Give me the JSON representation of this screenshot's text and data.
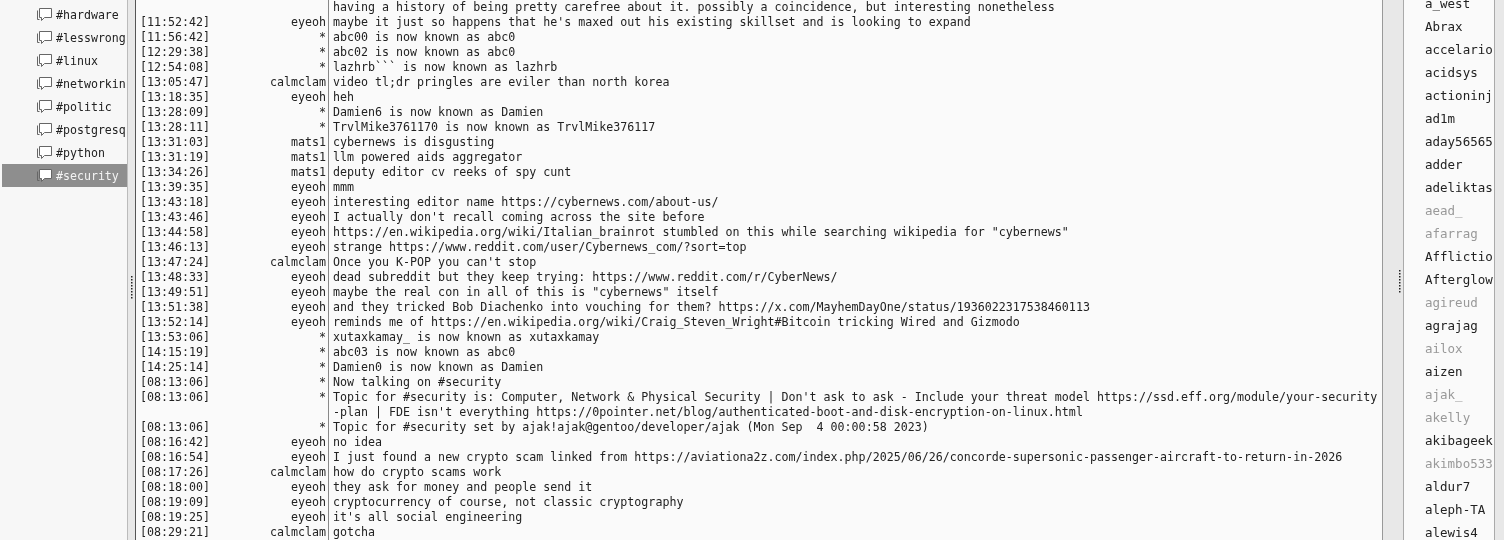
{
  "sidebar": {
    "channels": [
      {
        "label": "#hardware",
        "selected": false
      },
      {
        "label": "#lesswrong",
        "selected": false
      },
      {
        "label": "#linux",
        "selected": false
      },
      {
        "label": "#networkin",
        "selected": false
      },
      {
        "label": "#politic",
        "selected": false
      },
      {
        "label": "#postgresq",
        "selected": false
      },
      {
        "label": "#python",
        "selected": false
      },
      {
        "label": "#security",
        "selected": true
      }
    ]
  },
  "chat": {
    "lines": [
      {
        "text": "having a history of being pretty carefree about it. possibly a coincidence, but interesting nonetheless"
      },
      {
        "time": "[11:52:42]",
        "nick": "eyeoh",
        "text": "maybe it just so happens that he's maxed out his existing skillset and is looking to expand"
      },
      {
        "time": "[11:56:42]",
        "nick": "*",
        "text": "abc00 is now known as abc0"
      },
      {
        "time": "[12:29:38]",
        "nick": "*",
        "text": "abc02 is now known as abc0"
      },
      {
        "time": "[12:54:08]",
        "nick": "*",
        "text": "lazhrb``` is now known as lazhrb"
      },
      {
        "time": "[13:05:47]",
        "nick": "calmclam",
        "text": "video tl;dr pringles are eviler than north korea"
      },
      {
        "time": "[13:18:35]",
        "nick": "eyeoh",
        "text": "heh"
      },
      {
        "time": "[13:28:09]",
        "nick": "*",
        "text": "Damien6 is now known as Damien"
      },
      {
        "time": "[13:28:11]",
        "nick": "*",
        "text": "TrvlMike3761170 is now known as TrvlMike376117"
      },
      {
        "time": "[13:31:03]",
        "nick": "mats1",
        "text": "cybernews is disgusting"
      },
      {
        "time": "[13:31:19]",
        "nick": "mats1",
        "text": "llm powered aids aggregator"
      },
      {
        "time": "[13:34:26]",
        "nick": "mats1",
        "text": "deputy editor cv reeks of spy cunt"
      },
      {
        "time": "[13:39:35]",
        "nick": "eyeoh",
        "text": "mmm"
      },
      {
        "time": "[13:43:18]",
        "nick": "eyeoh",
        "text": "interesting editor name https://cybernews.com/about-us/"
      },
      {
        "time": "[13:43:46]",
        "nick": "eyeoh",
        "text": "I actually don't recall coming across the site before"
      },
      {
        "time": "[13:44:58]",
        "nick": "eyeoh",
        "text": "https://en.wikipedia.org/wiki/Italian_brainrot stumbled on this while searching wikipedia for \"cybernews\""
      },
      {
        "time": "[13:46:13]",
        "nick": "eyeoh",
        "text": "strange https://www.reddit.com/user/Cybernews_com/?sort=top"
      },
      {
        "time": "[13:47:24]",
        "nick": "calmclam",
        "text": "Once you K-POP you can't stop"
      },
      {
        "time": "[13:48:33]",
        "nick": "eyeoh",
        "text": "dead subreddit but they keep trying: https://www.reddit.com/r/CyberNews/"
      },
      {
        "time": "[13:49:51]",
        "nick": "eyeoh",
        "text": "maybe the real con in all of this is \"cybernews\" itself"
      },
      {
        "time": "[13:51:38]",
        "nick": "eyeoh",
        "text": "and they tricked Bob Diachenko into vouching for them? https://x.com/MayhemDayOne/status/1936022317538460113"
      },
      {
        "time": "[13:52:14]",
        "nick": "eyeoh",
        "text": "reminds me of https://en.wikipedia.org/wiki/Craig_Steven_Wright#Bitcoin tricking Wired and Gizmodo"
      },
      {
        "time": "[13:53:06]",
        "nick": "*",
        "text": "xutaxkamay_ is now known as xutaxkamay"
      },
      {
        "time": "[14:15:19]",
        "nick": "*",
        "text": "abc03 is now known as abc0"
      },
      {
        "time": "[14:25:14]",
        "nick": "*",
        "text": "Damien0 is now known as Damien"
      },
      {
        "time": "[08:13:06]",
        "nick": "*",
        "text": "Now talking on #security"
      },
      {
        "time": "[08:13:06]",
        "nick": "*",
        "text": "Topic for #security is: Computer, Network & Physical Security | Don't ask to ask - Include your threat model https://ssd.eff.org/module/your-security-plan | FDE isn't everything https://0pointer.net/blog/authenticated-boot-and-disk-encryption-on-linux.html"
      },
      {
        "time": "[08:13:06]",
        "nick": "*",
        "text": "Topic for #security set by ajak!ajak@gentoo/developer/ajak (Mon Sep  4 00:00:58 2023)"
      },
      {
        "time": "[08:16:42]",
        "nick": "eyeoh",
        "text": "no idea"
      },
      {
        "time": "[08:16:54]",
        "nick": "eyeoh",
        "text": "I just found a new crypto scam linked from https://aviationa2z.com/index.php/2025/06/26/concorde-supersonic-passenger-aircraft-to-return-in-2026"
      },
      {
        "time": "[08:17:26]",
        "nick": "calmclam",
        "text": "how do crypto scams work"
      },
      {
        "time": "[08:18:00]",
        "nick": "eyeoh",
        "text": "they ask for money and people send it"
      },
      {
        "time": "[08:19:09]",
        "nick": "eyeoh",
        "text": "cryptocurrency of course, not classic cryptography"
      },
      {
        "time": "[08:19:25]",
        "nick": "eyeoh",
        "text": "it's all social engineering"
      },
      {
        "time": "[08:29:21]",
        "nick": "calmclam",
        "text": "gotcha"
      }
    ]
  },
  "users": [
    {
      "name": "a_west",
      "away": false
    },
    {
      "name": "Abrax",
      "away": false
    },
    {
      "name": "accelario",
      "away": false
    },
    {
      "name": "acidsys",
      "away": false
    },
    {
      "name": "actioninj",
      "away": false
    },
    {
      "name": "ad1m",
      "away": false
    },
    {
      "name": "aday56565",
      "away": false
    },
    {
      "name": "adder",
      "away": false
    },
    {
      "name": "adeliktas",
      "away": false
    },
    {
      "name": "aead_",
      "away": true
    },
    {
      "name": "afarrag",
      "away": true
    },
    {
      "name": "Afflictio",
      "away": false
    },
    {
      "name": "Afterglow",
      "away": false
    },
    {
      "name": "agireud",
      "away": true
    },
    {
      "name": "agrajag",
      "away": false
    },
    {
      "name": "ailox",
      "away": true
    },
    {
      "name": "aizen",
      "away": false
    },
    {
      "name": "ajak_",
      "away": true
    },
    {
      "name": "akelly",
      "away": true
    },
    {
      "name": "akibageek",
      "away": false
    },
    {
      "name": "akimbo533",
      "away": true
    },
    {
      "name": "aldur7",
      "away": false
    },
    {
      "name": "aleph-TA",
      "away": false
    },
    {
      "name": "alewis4",
      "away": false
    }
  ]
}
